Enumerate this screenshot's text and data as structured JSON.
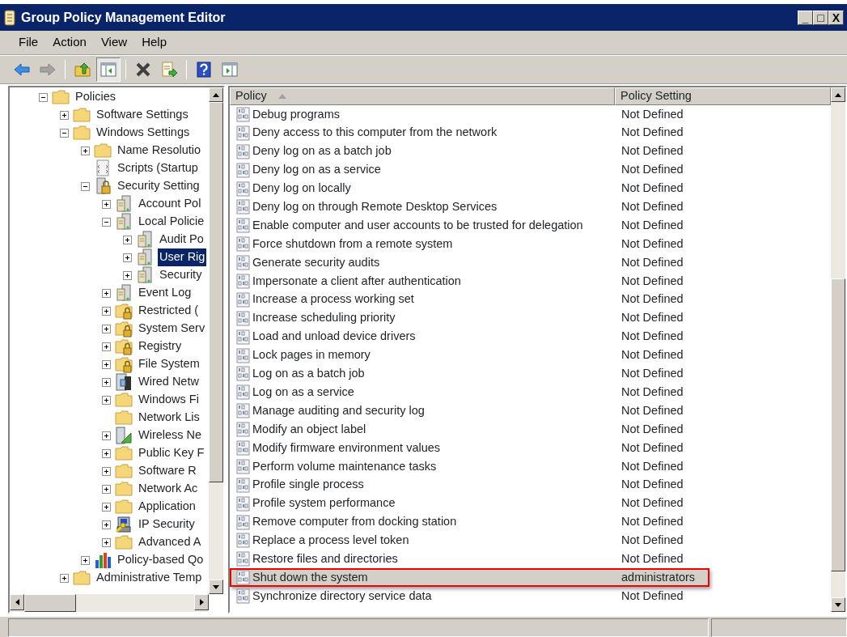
{
  "window": {
    "title": "Group Policy Management Editor",
    "controls": [
      "_",
      "□",
      "X"
    ]
  },
  "menu": [
    "File",
    "Action",
    "View",
    "Help"
  ],
  "toolbar": [
    {
      "kind": "back",
      "disabled": false,
      "pressed": false
    },
    {
      "kind": "forward",
      "disabled": true,
      "pressed": false
    },
    {
      "kind": "up",
      "disabled": false,
      "pressed": false
    },
    {
      "kind": "tree",
      "disabled": false,
      "pressed": true
    },
    {
      "kind": "delete",
      "disabled": false,
      "pressed": false
    },
    {
      "kind": "export",
      "disabled": false,
      "pressed": false
    },
    {
      "kind": "help",
      "disabled": false,
      "pressed": false
    },
    {
      "kind": "action-pane",
      "disabled": false,
      "pressed": false
    }
  ],
  "tree": [
    {
      "label": "Policies",
      "kind": "folder",
      "expandable": true,
      "expanded": true,
      "selected": false,
      "children": [
        {
          "label": "Software Settings",
          "kind": "folder",
          "expandable": true,
          "expanded": false,
          "selected": false
        },
        {
          "label": "Windows Settings",
          "kind": "folder",
          "expandable": true,
          "expanded": true,
          "selected": false,
          "children": [
            {
              "label": "Name Resolutio",
              "kind": "folder",
              "expandable": true,
              "expanded": false,
              "selected": false
            },
            {
              "label": "Scripts (Startup",
              "kind": "script",
              "expandable": false,
              "expanded": false,
              "selected": false
            },
            {
              "label": "Security Setting",
              "kind": "secure-server",
              "expandable": true,
              "expanded": true,
              "selected": false,
              "children": [
                {
                  "label": "Account Pol",
                  "kind": "server",
                  "expandable": true,
                  "expanded": false,
                  "selected": false
                },
                {
                  "label": "Local Policie",
                  "kind": "server",
                  "expandable": true,
                  "expanded": true,
                  "selected": false,
                  "children": [
                    {
                      "label": "Audit Po",
                      "kind": "server",
                      "expandable": true,
                      "expanded": false,
                      "selected": false
                    },
                    {
                      "label": "User Rig",
                      "kind": "server",
                      "expandable": true,
                      "expanded": false,
                      "selected": true
                    },
                    {
                      "label": "Security",
                      "kind": "server",
                      "expandable": true,
                      "expanded": false,
                      "selected": false
                    }
                  ]
                },
                {
                  "label": "Event Log",
                  "kind": "server",
                  "expandable": true,
                  "expanded": false,
                  "selected": false
                },
                {
                  "label": "Restricted (",
                  "kind": "secure-folder",
                  "expandable": true,
                  "expanded": false,
                  "selected": false
                },
                {
                  "label": "System Serv",
                  "kind": "secure-folder",
                  "expandable": true,
                  "expanded": false,
                  "selected": false
                },
                {
                  "label": "Registry",
                  "kind": "secure-folder",
                  "expandable": true,
                  "expanded": false,
                  "selected": false
                },
                {
                  "label": "File System",
                  "kind": "secure-folder",
                  "expandable": true,
                  "expanded": false,
                  "selected": false
                },
                {
                  "label": "Wired Netw",
                  "kind": "wired",
                  "expandable": true,
                  "expanded": false,
                  "selected": false
                },
                {
                  "label": "Windows Fi",
                  "kind": "folder",
                  "expandable": true,
                  "expanded": false,
                  "selected": false
                },
                {
                  "label": "Network Lis",
                  "kind": "folder",
                  "expandable": false,
                  "expanded": false,
                  "selected": false
                },
                {
                  "label": "Wireless Ne",
                  "kind": "wireless",
                  "expandable": true,
                  "expanded": false,
                  "selected": false
                },
                {
                  "label": "Public Key F",
                  "kind": "folder",
                  "expandable": true,
                  "expanded": false,
                  "selected": false
                },
                {
                  "label": "Software R",
                  "kind": "folder",
                  "expandable": true,
                  "expanded": false,
                  "selected": false
                },
                {
                  "label": "Network Ac",
                  "kind": "folder",
                  "expandable": true,
                  "expanded": false,
                  "selected": false
                },
                {
                  "label": "Application",
                  "kind": "folder",
                  "expandable": true,
                  "expanded": false,
                  "selected": false
                },
                {
                  "label": "IP Security",
                  "kind": "ipsec",
                  "expandable": true,
                  "expanded": false,
                  "selected": false
                },
                {
                  "label": "Advanced A",
                  "kind": "folder",
                  "expandable": true,
                  "expanded": false,
                  "selected": false
                }
              ]
            },
            {
              "label": "Policy-based Qo",
              "kind": "chart",
              "expandable": true,
              "expanded": false,
              "selected": false
            }
          ]
        },
        {
          "label": "Administrative Temp",
          "kind": "folder",
          "expandable": true,
          "expanded": false,
          "selected": false
        }
      ]
    }
  ],
  "table": {
    "columns": [
      {
        "label": "Policy",
        "sorted": true
      },
      {
        "label": "Policy Setting",
        "sorted": false
      }
    ],
    "rows": [
      {
        "policy": "Debug programs",
        "setting": "Not Defined",
        "selected": false,
        "highlighted": false
      },
      {
        "policy": "Deny access to this computer from the network",
        "setting": "Not Defined",
        "selected": false,
        "highlighted": false
      },
      {
        "policy": "Deny log on as a batch job",
        "setting": "Not Defined",
        "selected": false,
        "highlighted": false
      },
      {
        "policy": "Deny log on as a service",
        "setting": "Not Defined",
        "selected": false,
        "highlighted": false
      },
      {
        "policy": "Deny log on locally",
        "setting": "Not Defined",
        "selected": false,
        "highlighted": false
      },
      {
        "policy": "Deny log on through Remote Desktop Services",
        "setting": "Not Defined",
        "selected": false,
        "highlighted": false
      },
      {
        "policy": "Enable computer and user accounts to be trusted for delegation",
        "setting": "Not Defined",
        "selected": false,
        "highlighted": false
      },
      {
        "policy": "Force shutdown from a remote system",
        "setting": "Not Defined",
        "selected": false,
        "highlighted": false
      },
      {
        "policy": "Generate security audits",
        "setting": "Not Defined",
        "selected": false,
        "highlighted": false
      },
      {
        "policy": "Impersonate a client after authentication",
        "setting": "Not Defined",
        "selected": false,
        "highlighted": false
      },
      {
        "policy": "Increase a process working set",
        "setting": "Not Defined",
        "selected": false,
        "highlighted": false
      },
      {
        "policy": "Increase scheduling priority",
        "setting": "Not Defined",
        "selected": false,
        "highlighted": false
      },
      {
        "policy": "Load and unload device drivers",
        "setting": "Not Defined",
        "selected": false,
        "highlighted": false
      },
      {
        "policy": "Lock pages in memory",
        "setting": "Not Defined",
        "selected": false,
        "highlighted": false
      },
      {
        "policy": "Log on as a batch job",
        "setting": "Not Defined",
        "selected": false,
        "highlighted": false
      },
      {
        "policy": "Log on as a service",
        "setting": "Not Defined",
        "selected": false,
        "highlighted": false
      },
      {
        "policy": "Manage auditing and security log",
        "setting": "Not Defined",
        "selected": false,
        "highlighted": false
      },
      {
        "policy": "Modify an object label",
        "setting": "Not Defined",
        "selected": false,
        "highlighted": false
      },
      {
        "policy": "Modify firmware environment values",
        "setting": "Not Defined",
        "selected": false,
        "highlighted": false
      },
      {
        "policy": "Perform volume maintenance tasks",
        "setting": "Not Defined",
        "selected": false,
        "highlighted": false
      },
      {
        "policy": "Profile single process",
        "setting": "Not Defined",
        "selected": false,
        "highlighted": false
      },
      {
        "policy": "Profile system performance",
        "setting": "Not Defined",
        "selected": false,
        "highlighted": false
      },
      {
        "policy": "Remove computer from docking station",
        "setting": "Not Defined",
        "selected": false,
        "highlighted": false
      },
      {
        "policy": "Replace a process level token",
        "setting": "Not Defined",
        "selected": false,
        "highlighted": false
      },
      {
        "policy": "Restore files and directories",
        "setting": "Not Defined",
        "selected": false,
        "highlighted": false
      },
      {
        "policy": "Shut down the system",
        "setting": "administrators",
        "selected": true,
        "highlighted": true
      },
      {
        "policy": "Synchronize directory service data",
        "setting": "Not Defined",
        "selected": false,
        "highlighted": false
      }
    ]
  }
}
